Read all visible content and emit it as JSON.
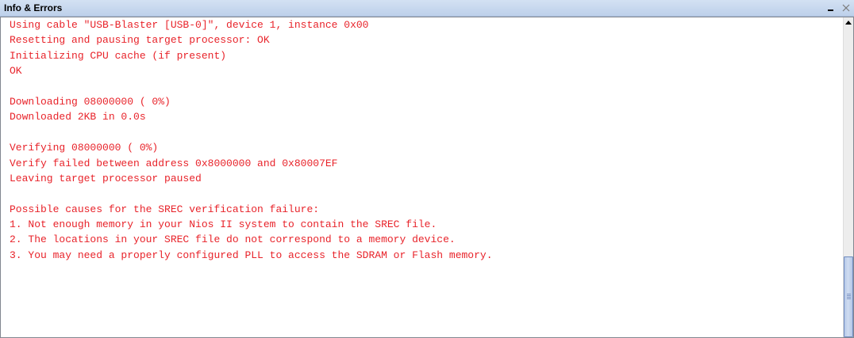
{
  "panel": {
    "title": "Info & Errors",
    "minimize_icon": "minimize-icon",
    "close_icon": "close-icon",
    "text_color": "#e8232a",
    "titlebar_color": "#c6d7ee"
  },
  "console": {
    "lines": [
      "Using cable \"USB-Blaster [USB-0]\", device 1, instance 0x00",
      "Resetting and pausing target processor: OK",
      "Initializing CPU cache (if present)",
      "OK",
      "",
      "Downloading 08000000 ( 0%)",
      "Downloaded 2KB in 0.0s",
      "",
      "Verifying 08000000 ( 0%)",
      "Verify failed between address 0x8000000 and 0x80007EF",
      "Leaving target processor paused",
      "",
      "Possible causes for the SREC verification failure:",
      "1. Not enough memory in your Nios II system to contain the SREC file.",
      "2. The locations in your SREC file do not correspond to a memory device.",
      "3. You may need a properly configured PLL to access the SDRAM or Flash memory."
    ]
  },
  "scrollbar": {
    "up_icon": "scroll-up-arrow-icon",
    "position_fraction": 0.78
  }
}
